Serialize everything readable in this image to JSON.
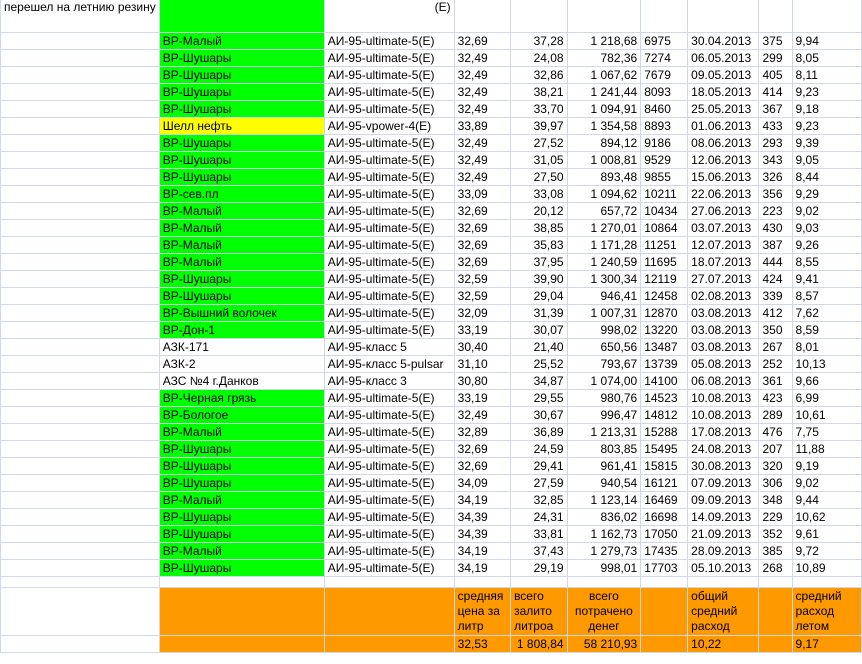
{
  "note": "перешел на летнию резину",
  "top_partial": "(Е)",
  "rows": [
    {
      "station": "ВР-Малый",
      "fuel": "АИ-95-ultimate-5(Е)",
      "price": "32,69",
      "liters": "37,28",
      "cost": "1 218,68",
      "odometer": "6975",
      "date": "30.04.2013",
      "distance": "375",
      "consumption": "9,94",
      "color": "#00ff00"
    },
    {
      "station": "ВР-Шушары",
      "fuel": "АИ-95-ultimate-5(Е)",
      "price": "32,49",
      "liters": "24,08",
      "cost": "782,36",
      "odometer": "7274",
      "date": "06.05.2013",
      "distance": "299",
      "consumption": "8,05",
      "color": "#00ff00"
    },
    {
      "station": "ВР-Шушары",
      "fuel": "АИ-95-ultimate-5(Е)",
      "price": "32,49",
      "liters": "32,86",
      "cost": "1 067,62",
      "odometer": "7679",
      "date": "09.05.2013",
      "distance": "405",
      "consumption": "8,11",
      "color": "#00ff00"
    },
    {
      "station": "ВР-Шушары",
      "fuel": "АИ-95-ultimate-5(Е)",
      "price": "32,49",
      "liters": "38,21",
      "cost": "1 241,44",
      "odometer": "8093",
      "date": "18.05.2013",
      "distance": "414",
      "consumption": "9,23",
      "color": "#00ff00"
    },
    {
      "station": "ВР-Шушары",
      "fuel": "АИ-95-ultimate-5(Е)",
      "price": "32,49",
      "liters": "33,70",
      "cost": "1 094,91",
      "odometer": "8460",
      "date": "25.05.2013",
      "distance": "367",
      "consumption": "9,18",
      "color": "#00ff00"
    },
    {
      "station": "Шелл нефть",
      "fuel": "АИ-95-vpower-4(Е)",
      "price": "33,89",
      "liters": "39,97",
      "cost": "1 354,58",
      "odometer": "8893",
      "date": "01.06.2013",
      "distance": "433",
      "consumption": "9,23",
      "color": "#ffff00"
    },
    {
      "station": "ВР-Шушары",
      "fuel": "АИ-95-ultimate-5(Е)",
      "price": "32,49",
      "liters": "27,52",
      "cost": "894,12",
      "odometer": "9186",
      "date": "08.06.2013",
      "distance": "293",
      "consumption": "9,39",
      "color": "#00ff00"
    },
    {
      "station": "ВР-Шушары",
      "fuel": "АИ-95-ultimate-5(Е)",
      "price": "32,49",
      "liters": "31,05",
      "cost": "1 008,81",
      "odometer": "9529",
      "date": "12.06.2013",
      "distance": "343",
      "consumption": "9,05",
      "color": "#00ff00"
    },
    {
      "station": "ВР-Шушары",
      "fuel": "АИ-95-ultimate-5(Е)",
      "price": "32,49",
      "liters": "27,50",
      "cost": "893,48",
      "odometer": "9855",
      "date": "15.06.2013",
      "distance": "326",
      "consumption": "8,44",
      "color": "#00ff00"
    },
    {
      "station": "ВР-сев.пл",
      "fuel": "АИ-95-ultimate-5(Е)",
      "price": "33,09",
      "liters": "33,08",
      "cost": "1 094,62",
      "odometer": "10211",
      "date": "22.06.2013",
      "distance": "356",
      "consumption": "9,29",
      "color": "#00ff00"
    },
    {
      "station": "ВР-Малый",
      "fuel": "АИ-95-ultimate-5(Е)",
      "price": "32,69",
      "liters": "20,12",
      "cost": "657,72",
      "odometer": "10434",
      "date": "27.06.2013",
      "distance": "223",
      "consumption": "9,02",
      "color": "#00ff00"
    },
    {
      "station": "ВР-Малый",
      "fuel": "АИ-95-ultimate-5(Е)",
      "price": "32,69",
      "liters": "38,85",
      "cost": "1 270,01",
      "odometer": "10864",
      "date": "03.07.2013",
      "distance": "430",
      "consumption": "9,03",
      "color": "#00ff00"
    },
    {
      "station": "ВР-Малый",
      "fuel": "АИ-95-ultimate-5(Е)",
      "price": "32,69",
      "liters": "35,83",
      "cost": "1 171,28",
      "odometer": "11251",
      "date": "12.07.2013",
      "distance": "387",
      "consumption": "9,26",
      "color": "#00ff00"
    },
    {
      "station": "ВР-Малый",
      "fuel": "АИ-95-ultimate-5(Е)",
      "price": "32,69",
      "liters": "37,95",
      "cost": "1 240,59",
      "odometer": "11695",
      "date": "18.07.2013",
      "distance": "444",
      "consumption": "8,55",
      "color": "#00ff00"
    },
    {
      "station": "ВР-Шушары",
      "fuel": "АИ-95-ultimate-5(Е)",
      "price": "32,59",
      "liters": "39,90",
      "cost": "1 300,34",
      "odometer": "12119",
      "date": "27.07.2013",
      "distance": "424",
      "consumption": "9,41",
      "color": "#00ff00"
    },
    {
      "station": "ВР-Шушары",
      "fuel": "АИ-95-ultimate-5(Е)",
      "price": "32,59",
      "liters": "29,04",
      "cost": "946,41",
      "odometer": "12458",
      "date": "02.08.2013",
      "distance": "339",
      "consumption": "8,57",
      "color": "#00ff00"
    },
    {
      "station": "ВР-Вышний волочек",
      "fuel": "АИ-95-ultimate-5(Е)",
      "price": "32,09",
      "liters": "31,39",
      "cost": "1 007,31",
      "odometer": "12870",
      "date": "03.08.2013",
      "distance": "412",
      "consumption": "7,62",
      "color": "#00ff00"
    },
    {
      "station": "ВР-Дон-1",
      "fuel": "АИ-95-ultimate-5(Е)",
      "price": "33,19",
      "liters": "30,07",
      "cost": "998,02",
      "odometer": "13220",
      "date": "03.08.2013",
      "distance": "350",
      "consumption": "8,59",
      "color": "#00ff00"
    },
    {
      "station": "АЗК-171",
      "fuel": "АИ-95-класс 5",
      "price": "30,40",
      "liters": "21,40",
      "cost": "650,56",
      "odometer": "13487",
      "date": "03.08.2013",
      "distance": "267",
      "consumption": "8,01",
      "color": ""
    },
    {
      "station": "АЗК-2",
      "fuel": "АИ-95-класс 5-pulsar",
      "price": "31,10",
      "liters": "25,52",
      "cost": "793,67",
      "odometer": "13739",
      "date": "05.08.2013",
      "distance": "252",
      "consumption": "10,13",
      "color": ""
    },
    {
      "station": "АЗС №4 г.Данков",
      "fuel": "АИ-95-класс 3",
      "price": "30,80",
      "liters": "34,87",
      "cost": "1 074,00",
      "odometer": "14100",
      "date": "06.08.2013",
      "distance": "361",
      "consumption": "9,66",
      "color": ""
    },
    {
      "station": "ВР-Черная грязь",
      "fuel": "АИ-95-ultimate-5(Е)",
      "price": "33,19",
      "liters": "29,55",
      "cost": "980,76",
      "odometer": "14523",
      "date": "10.08.2013",
      "distance": "423",
      "consumption": "6,99",
      "color": "#00ff00"
    },
    {
      "station": "ВР-Бологое",
      "fuel": "АИ-95-ultimate-5(Е)",
      "price": "32,49",
      "liters": "30,67",
      "cost": "996,47",
      "odometer": "14812",
      "date": "10.08.2013",
      "distance": "289",
      "consumption": "10,61",
      "color": "#00ff00"
    },
    {
      "station": "ВР-Малый",
      "fuel": "АИ-95-ultimate-5(Е)",
      "price": "32,89",
      "liters": "36,89",
      "cost": "1 213,31",
      "odometer": "15288",
      "date": "17.08.2013",
      "distance": "476",
      "consumption": "7,75",
      "color": "#00ff00"
    },
    {
      "station": "ВР-Шушары",
      "fuel": "АИ-95-ultimate-5(Е)",
      "price": "32,69",
      "liters": "24,59",
      "cost": "803,85",
      "odometer": "15495",
      "date": "24.08.2013",
      "distance": "207",
      "consumption": "11,88",
      "color": "#00ff00"
    },
    {
      "station": "ВР-Шушары",
      "fuel": "АИ-95-ultimate-5(Е)",
      "price": "32,69",
      "liters": "29,41",
      "cost": "961,41",
      "odometer": "15815",
      "date": "30.08.2013",
      "distance": "320",
      "consumption": "9,19",
      "color": "#00ff00"
    },
    {
      "station": "ВР-Шушары",
      "fuel": "АИ-95-ultimate-5(Е)",
      "price": "34,09",
      "liters": "27,59",
      "cost": "940,54",
      "odometer": "16121",
      "date": "07.09.2013",
      "distance": "306",
      "consumption": "9,02",
      "color": "#00ff00"
    },
    {
      "station": "ВР-Малый",
      "fuel": "АИ-95-ultimate-5(Е)",
      "price": "34,19",
      "liters": "32,85",
      "cost": "1 123,14",
      "odometer": "16469",
      "date": "09.09.2013",
      "distance": "348",
      "consumption": "9,44",
      "color": "#00ff00"
    },
    {
      "station": "ВР-Шушары",
      "fuel": "АИ-95-ultimate-5(Е)",
      "price": "34,39",
      "liters": "24,31",
      "cost": "836,02",
      "odometer": "16698",
      "date": "14.09.2013",
      "distance": "229",
      "consumption": "10,62",
      "color": "#00ff00"
    },
    {
      "station": "ВР-Шушары",
      "fuel": "АИ-95-ultimate-5(Е)",
      "price": "34,39",
      "liters": "33,81",
      "cost": "1 162,73",
      "odometer": "17050",
      "date": "21.09.2013",
      "distance": "352",
      "consumption": "9,61",
      "color": "#00ff00"
    },
    {
      "station": "ВР-Малый",
      "fuel": "АИ-95-ultimate-5(Е)",
      "price": "34,19",
      "liters": "37,43",
      "cost": "1 279,73",
      "odometer": "17435",
      "date": "28.09.2013",
      "distance": "385",
      "consumption": "9,72",
      "color": "#00ff00"
    },
    {
      "station": "ВР-Шушары",
      "fuel": "АИ-95-ultimate-5(Е)",
      "price": "34,19",
      "liters": "29,19",
      "cost": "998,01",
      "odometer": "17703",
      "date": "05.10.2013",
      "distance": "268",
      "consumption": "10,89",
      "color": "#00ff00"
    }
  ],
  "summary": {
    "avg_price_label": "средняя цена за литр",
    "total_liters_label": "всего залито литроа",
    "total_cost_label": "всего потрачено денег",
    "avg_consumption_label": "общий средний расход",
    "summer_consumption_label": "средний расход летом",
    "avg_price": "32,53",
    "total_liters": "1 808,84",
    "total_cost": "58 210,93",
    "avg_consumption": "10,22",
    "summer_consumption": "9,17"
  },
  "colors": {
    "green": "#00ff00",
    "yellow": "#ffff00",
    "orange": "#ff9900",
    "grid": "#d0d7e5"
  }
}
